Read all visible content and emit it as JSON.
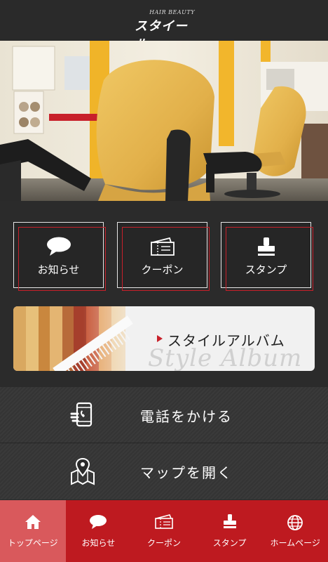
{
  "header": {
    "logo_small": "HAIR BEAUTY",
    "logo_main": "スタイール"
  },
  "grid": [
    {
      "id": "news",
      "label": "お知らせ",
      "icon": "speech-bubble-icon"
    },
    {
      "id": "coupon",
      "label": "クーポン",
      "icon": "ticket-icon"
    },
    {
      "id": "stamp",
      "label": "スタンプ",
      "icon": "stamp-icon"
    }
  ],
  "album": {
    "label": "スタイルアルバム",
    "script": "Style Album"
  },
  "actions": {
    "call_label": "電話をかける",
    "map_label": "マップを開く"
  },
  "nav": [
    {
      "label": "トップページ",
      "icon": "home-icon",
      "active": true
    },
    {
      "label": "お知らせ",
      "icon": "speech-bubble-icon",
      "active": false
    },
    {
      "label": "クーポン",
      "icon": "ticket-icon",
      "active": false
    },
    {
      "label": "スタンプ",
      "icon": "stamp-icon",
      "active": false
    },
    {
      "label": "ホームページ",
      "icon": "globe-icon",
      "active": false
    }
  ],
  "colors": {
    "background": "#2b2b2b",
    "accent_red": "#be1a20",
    "active_tab": "#d9595c",
    "salon_chair": "#e8b84a"
  }
}
